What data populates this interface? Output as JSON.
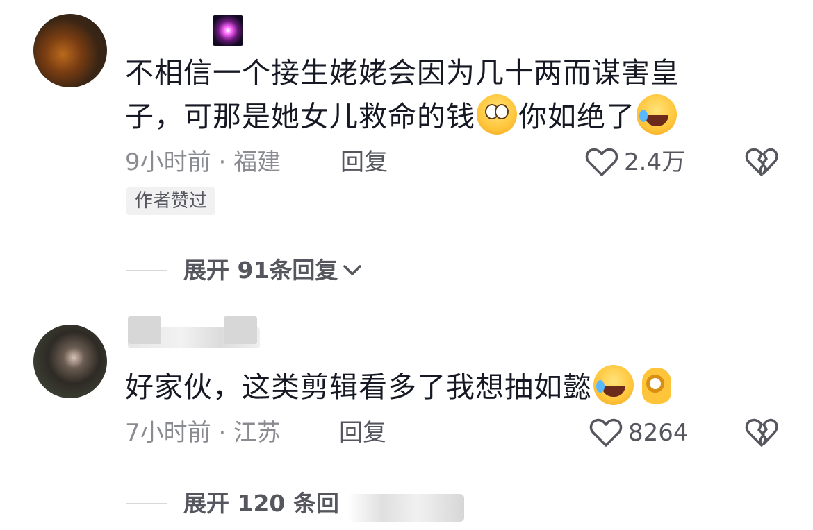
{
  "comments": [
    {
      "text_parts": [
        "不相信一个接生姥姥会因为几十两而谋害皇子，可那是她女儿救命的钱",
        "你如绝了"
      ],
      "emojis": [
        "eye-roll-emoji",
        "laughing-crying-emoji"
      ],
      "time_location": "9小时前 · 福建",
      "reply_label": "回复",
      "like_count": "2.4万",
      "author_tag": "作者赞过",
      "expand_label": "展开 91条回复"
    },
    {
      "text_parts": [
        "好家伙，这类剪辑看多了我想抽如懿"
      ],
      "emojis": [
        "laughing-crying-emoji",
        "ok-hand-emoji"
      ],
      "time_location": "7小时前 · 江苏",
      "reply_label": "回复",
      "like_count": "8264",
      "expand_label": "展开 120 条回"
    }
  ],
  "colors": {
    "text_primary": "#161823",
    "text_secondary": "#8a8b91",
    "icon_gray": "#55565e"
  }
}
